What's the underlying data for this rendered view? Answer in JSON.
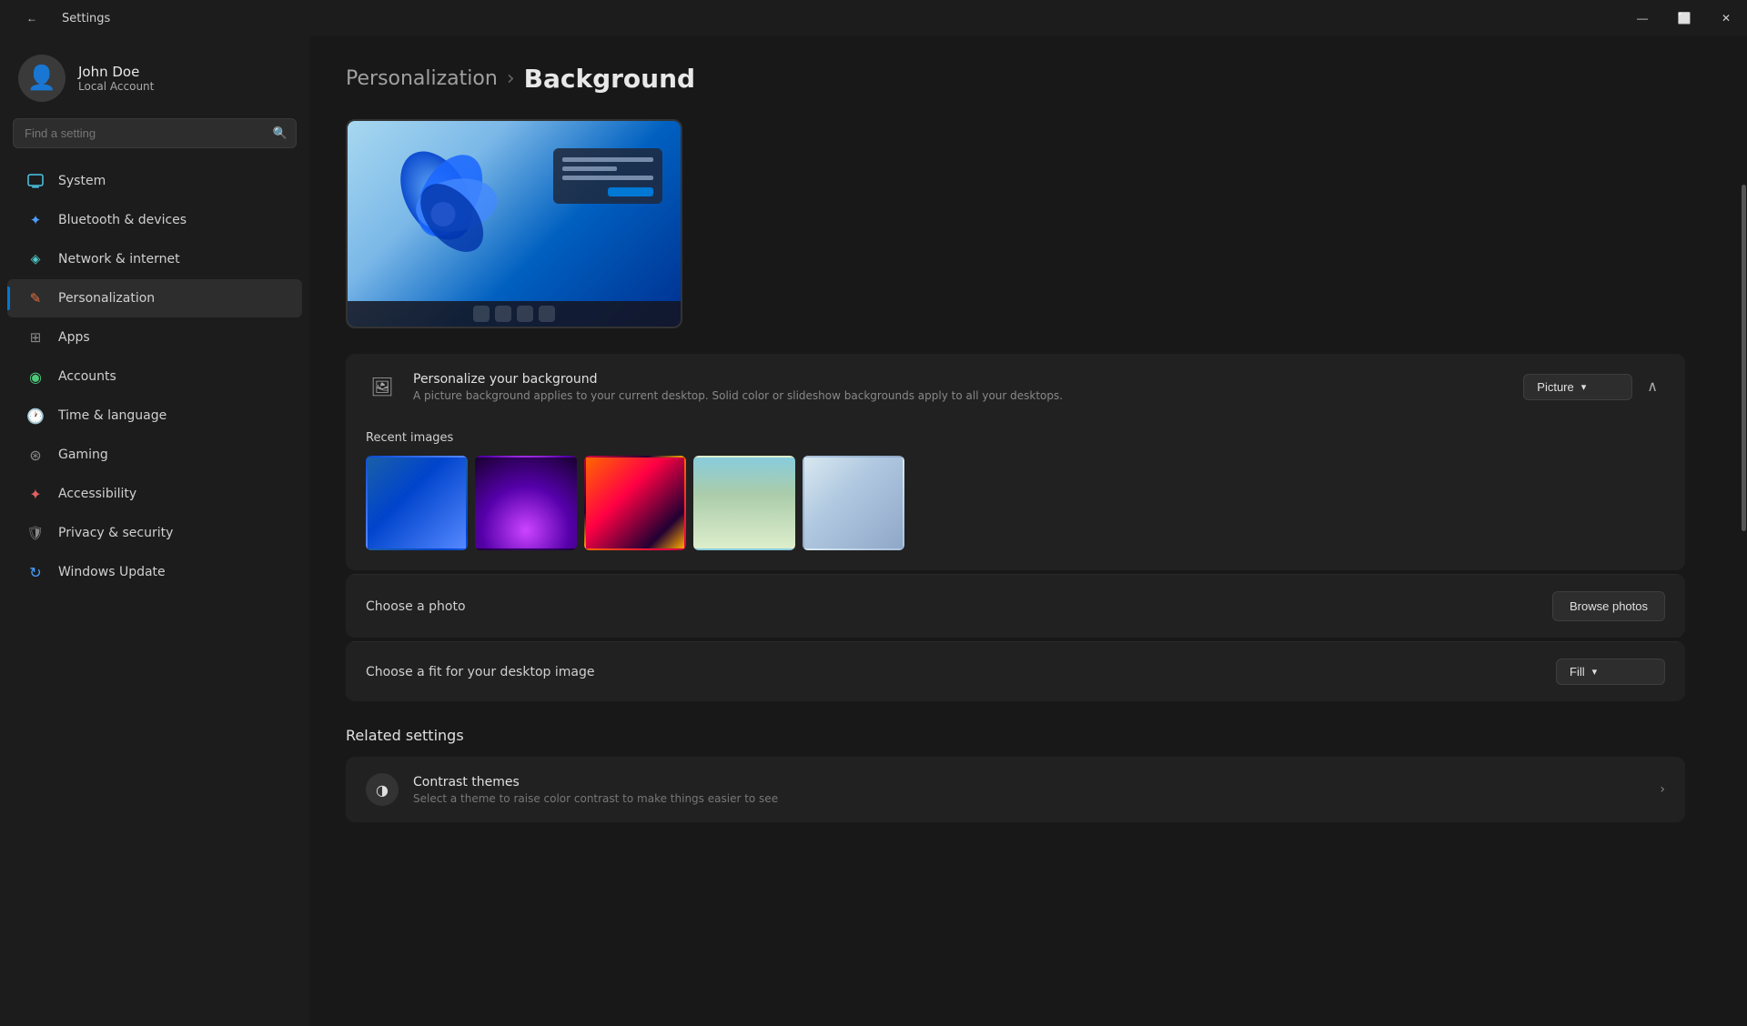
{
  "titlebar": {
    "title": "Settings",
    "back_icon": "←",
    "minimize": "—",
    "maximize": "⬜",
    "close": "✕"
  },
  "user": {
    "name": "John Doe",
    "type": "Local Account"
  },
  "search": {
    "placeholder": "Find a setting"
  },
  "nav": {
    "items": [
      {
        "id": "system",
        "label": "System",
        "icon": "🖥",
        "icon_class": "icon-system"
      },
      {
        "id": "bluetooth",
        "label": "Bluetooth & devices",
        "icon": "🔷",
        "icon_class": "icon-bluetooth"
      },
      {
        "id": "network",
        "label": "Network & internet",
        "icon": "📶",
        "icon_class": "icon-network"
      },
      {
        "id": "personalization",
        "label": "Personalization",
        "icon": "✏",
        "icon_class": "icon-personalization",
        "active": true
      },
      {
        "id": "apps",
        "label": "Apps",
        "icon": "⊞",
        "icon_class": "icon-apps"
      },
      {
        "id": "accounts",
        "label": "Accounts",
        "icon": "👤",
        "icon_class": "icon-accounts"
      },
      {
        "id": "time",
        "label": "Time & language",
        "icon": "🕐",
        "icon_class": "icon-time"
      },
      {
        "id": "gaming",
        "label": "Gaming",
        "icon": "🎮",
        "icon_class": "icon-gaming"
      },
      {
        "id": "accessibility",
        "label": "Accessibility",
        "icon": "♿",
        "icon_class": "icon-accessibility"
      },
      {
        "id": "privacy",
        "label": "Privacy & security",
        "icon": "🛡",
        "icon_class": "icon-privacy"
      },
      {
        "id": "update",
        "label": "Windows Update",
        "icon": "🔄",
        "icon_class": "icon-update"
      }
    ]
  },
  "breadcrumb": {
    "parent": "Personalization",
    "separator": "›",
    "current": "Background"
  },
  "personalize_section": {
    "icon": "🖼",
    "title": "Personalize your background",
    "description": "A picture background applies to your current desktop. Solid color or slideshow backgrounds apply to all your desktops.",
    "dropdown_label": "Picture",
    "expand_icon": "∧"
  },
  "recent_images": {
    "label": "Recent images",
    "thumbs": [
      {
        "id": 1,
        "class": "thumb-1"
      },
      {
        "id": 2,
        "class": "thumb-2"
      },
      {
        "id": 3,
        "class": "thumb-3"
      },
      {
        "id": 4,
        "class": "thumb-4"
      },
      {
        "id": 5,
        "class": "thumb-5"
      }
    ]
  },
  "choose_photo": {
    "label": "Choose a photo",
    "button": "Browse photos"
  },
  "choose_fit": {
    "label": "Choose a fit for your desktop image",
    "dropdown_label": "Fill"
  },
  "related_settings": {
    "title": "Related settings",
    "items": [
      {
        "id": "contrast",
        "title": "Contrast themes",
        "description": "Select a theme to raise color contrast to make things easier to see",
        "icon": "◑"
      }
    ]
  }
}
